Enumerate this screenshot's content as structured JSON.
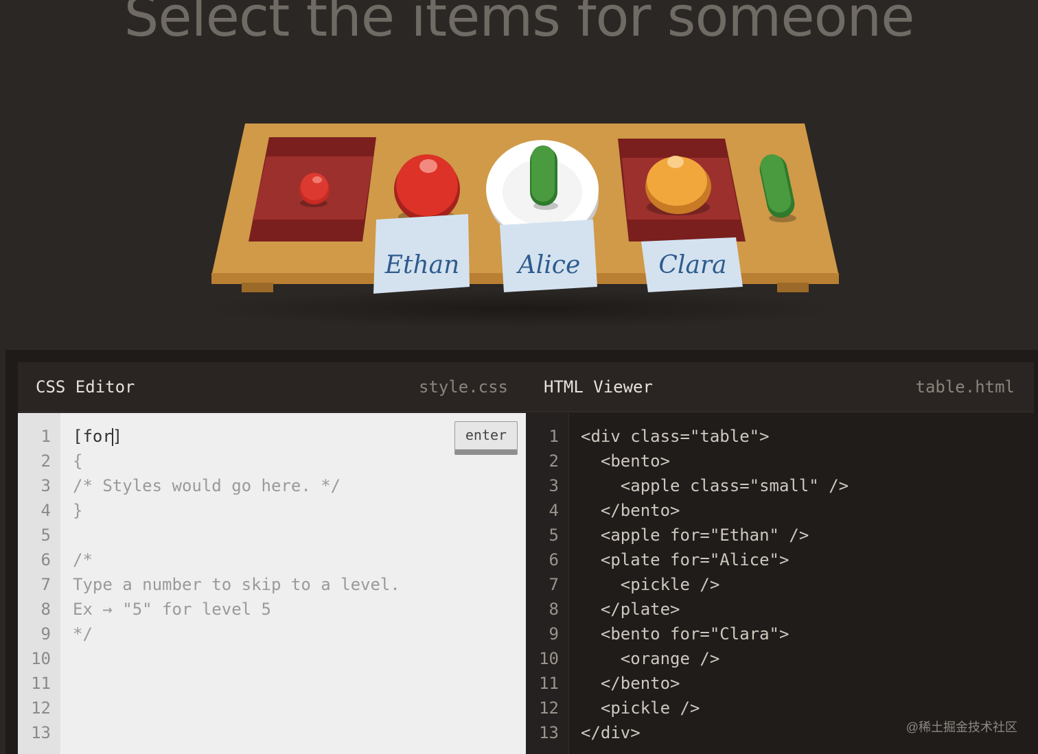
{
  "title": "Select the items for someone",
  "table": {
    "cards": [
      "Ethan",
      "Alice",
      "Clara"
    ]
  },
  "css_editor": {
    "title": "CSS Editor",
    "file": "style.css",
    "enter_label": "enter",
    "input_before_cursor": "[for",
    "input_after_cursor": "]",
    "lines": [
      "{",
      "/* Styles would go here. */",
      "}",
      "",
      "/*",
      "Type a number to skip to a level.",
      "Ex → \"5\" for level 5",
      "*/",
      "",
      "",
      "",
      ""
    ],
    "line_numbers": [
      "1",
      "2",
      "3",
      "4",
      "5",
      "6",
      "7",
      "8",
      "9",
      "10",
      "11",
      "12",
      "13"
    ]
  },
  "html_viewer": {
    "title": "HTML Viewer",
    "file": "table.html",
    "lines": [
      "<div class=\"table\">",
      "  <bento>",
      "    <apple class=\"small\" />",
      "  </bento>",
      "  <apple for=\"Ethan\" />",
      "  <plate for=\"Alice\">",
      "    <pickle />",
      "  </plate>",
      "  <bento for=\"Clara\">",
      "    <orange />",
      "  </bento>",
      "  <pickle />",
      "</div>"
    ],
    "line_numbers": [
      "1",
      "2",
      "3",
      "4",
      "5",
      "6",
      "7",
      "8",
      "9",
      "10",
      "11",
      "12",
      "13"
    ]
  },
  "watermark": "@稀土掘金技术社区",
  "colors": {
    "background": "#2b2724",
    "table": "#d09a48",
    "bento": "#8e2a28",
    "apple": "#d6302a",
    "orange": "#f0a63a",
    "pickle": "#3f8e3a",
    "card": "#d4e2f0"
  }
}
